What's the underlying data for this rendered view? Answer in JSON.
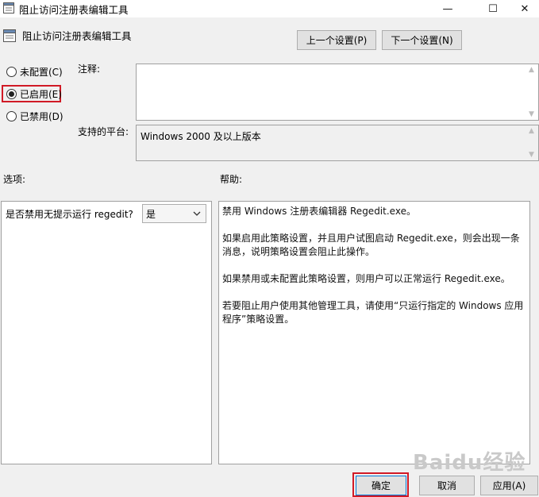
{
  "window": {
    "title": "阻止访问注册表编辑工具",
    "minimize": "—",
    "maximize": "☐",
    "close": "✕"
  },
  "header": {
    "title": "阻止访问注册表编辑工具",
    "prev_button": "上一个设置(P)",
    "next_button": "下一个设置(N)"
  },
  "state": {
    "not_configured": "未配置(C)",
    "enabled": "已启用(E)",
    "disabled": "已禁用(D)",
    "selected": "enabled"
  },
  "comment": {
    "label": "注释:",
    "value": ""
  },
  "platform": {
    "label": "支持的平台:",
    "value": "Windows 2000 及以上版本"
  },
  "options": {
    "label": "选项:",
    "question": "是否禁用无提示运行 regedit?",
    "selected_value": "是"
  },
  "help": {
    "label": "帮助:",
    "paragraphs": [
      "禁用 Windows 注册表编辑器 Regedit.exe。",
      "如果启用此策略设置，并且用户试图启动 Regedit.exe，则会出现一条消息，说明策略设置会阻止此操作。",
      "如果禁用或未配置此策略设置，则用户可以正常运行 Regedit.exe。",
      "若要阻止用户使用其他管理工具，请使用“只运行指定的 Windows 应用程序”策略设置。"
    ]
  },
  "footer": {
    "ok": "确定",
    "cancel": "取消",
    "apply": "应用(A)"
  },
  "watermark": "Baidu经验",
  "colors": {
    "highlight_red": "#d11a26",
    "background": "#f0f0f0"
  }
}
